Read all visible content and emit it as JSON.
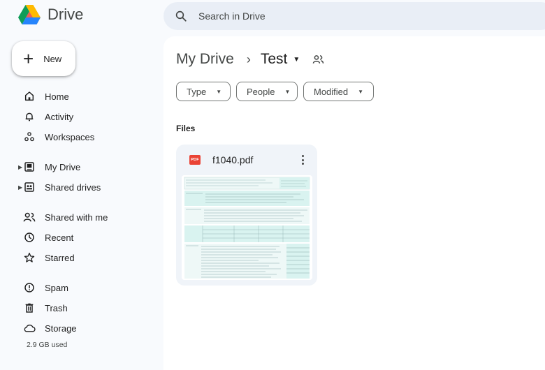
{
  "app": {
    "name": "Drive"
  },
  "search": {
    "placeholder": "Search in Drive"
  },
  "new_button": {
    "label": "New"
  },
  "sidebar": {
    "items": [
      {
        "label": "Home",
        "icon": "home-icon"
      },
      {
        "label": "Activity",
        "icon": "bell-icon"
      },
      {
        "label": "Workspaces",
        "icon": "workspaces-icon"
      },
      {
        "label": "My Drive",
        "icon": "my-drive-icon"
      },
      {
        "label": "Shared drives",
        "icon": "shared-drives-icon"
      },
      {
        "label": "Shared with me",
        "icon": "people-icon"
      },
      {
        "label": "Recent",
        "icon": "clock-icon"
      },
      {
        "label": "Starred",
        "icon": "star-icon"
      },
      {
        "label": "Spam",
        "icon": "spam-icon"
      },
      {
        "label": "Trash",
        "icon": "trash-icon"
      },
      {
        "label": "Storage",
        "icon": "cloud-icon"
      }
    ],
    "storage_used": "2.9 GB used"
  },
  "breadcrumb": {
    "root": "My Drive",
    "current": "Test"
  },
  "filters": [
    {
      "label": "Type"
    },
    {
      "label": "People"
    },
    {
      "label": "Modified"
    }
  ],
  "section": {
    "title": "Files"
  },
  "files": [
    {
      "name": "f1040.pdf",
      "badge": "PDF",
      "type_icon": "pdf-icon"
    }
  ],
  "colors": {
    "background": "#f8fafd",
    "search_bg": "#e9eef6",
    "card_bg": "#f0f4f9",
    "pdf_red": "#ea4335",
    "thumb_tint": "#d9f3f0"
  }
}
